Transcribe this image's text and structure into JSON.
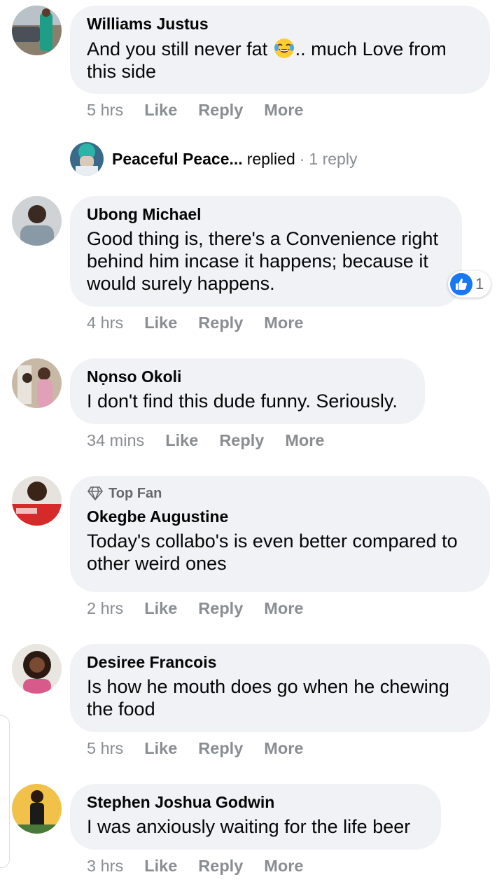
{
  "comments": [
    {
      "name": "Williams Justus",
      "text_before": "And you still never fat ",
      "emoji": "face-with-tears-of-joy",
      "text_after": ".. much Love from this side",
      "time": "5 hrs",
      "like": "Like",
      "reply": "Reply",
      "more": "More"
    },
    {
      "name": "Ubong Michael",
      "text": "Good thing is, there's a Convenience right behind him incase it happens; because it would surely happens.",
      "time": "4 hrs",
      "like": "Like",
      "reply": "Reply",
      "more": "More",
      "reaction": {
        "icon": "thumbs-up-icon",
        "count": "1"
      }
    },
    {
      "name": "Nọnso Okoli",
      "text": "I don't find this dude funny. Seriously.",
      "time": "34 mins",
      "like": "Like",
      "reply": "Reply",
      "more": "More"
    },
    {
      "badge": "Top Fan",
      "name": "Okegbe Augustine",
      "text": "Today's collabo's is even better compared to other weird ones",
      "time": "2 hrs",
      "like": "Like",
      "reply": "Reply",
      "more": "More"
    },
    {
      "name": "Desiree Francois",
      "text": "Is how he mouth does go when he chewing the food",
      "time": "5 hrs",
      "like": "Like",
      "reply": "Reply",
      "more": "More"
    },
    {
      "name": "Stephen Joshua Godwin",
      "text": "I was anxiously waiting for the life beer",
      "time": "3 hrs",
      "like": "Like",
      "reply": "Reply",
      "more": "More"
    }
  ],
  "reply_summary": {
    "name": "Peaceful Peace...",
    "word": "replied",
    "separator": "·",
    "count": "1 reply"
  },
  "colors": {
    "bubble": "#f0f2f5",
    "meta": "#8a8d91",
    "like_blue": "#1877f2"
  }
}
